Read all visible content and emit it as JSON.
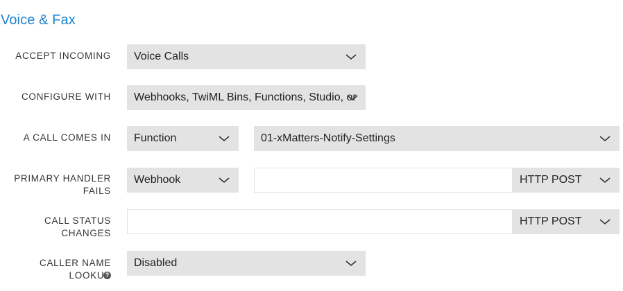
{
  "section_title": "Voice & Fax",
  "rows": {
    "accept_incoming": {
      "label": "ACCEPT INCOMING",
      "value": "Voice Calls"
    },
    "configure_with": {
      "label": "CONFIGURE WITH",
      "value": "Webhooks, TwiML Bins, Functions, Studio, or"
    },
    "call_comes_in": {
      "label": "A CALL COMES IN",
      "type": "Function",
      "target": "01-xMatters-Notify-Settings"
    },
    "primary_handler_fails": {
      "label_line1": "PRIMARY HANDLER",
      "label_line2": "FAILS",
      "type": "Webhook",
      "url": "",
      "method": "HTTP POST"
    },
    "call_status_changes": {
      "label_line1": "CALL STATUS",
      "label_line2": "CHANGES",
      "url": "",
      "method": "HTTP POST"
    },
    "caller_name_lookup": {
      "label": "CALLER NAME LOOKUP",
      "value": "Disabled",
      "help_icon": "question-circle-icon"
    }
  }
}
